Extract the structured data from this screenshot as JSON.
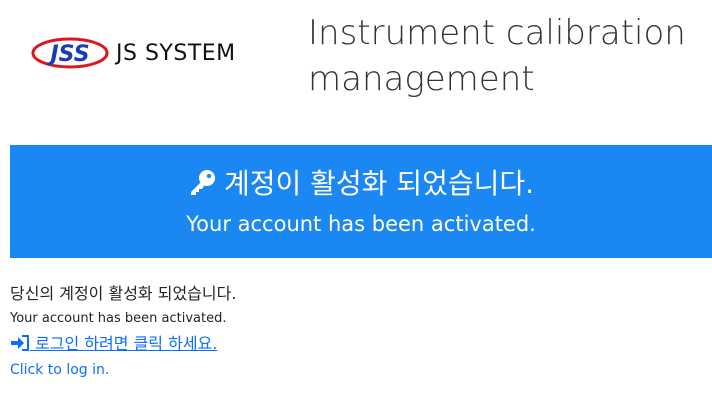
{
  "header": {
    "logo_text": "JSS",
    "brand_name": "JS SYSTEM",
    "app_title": "Instrument calibration management"
  },
  "banner": {
    "icon": "key-icon",
    "title_ko": "계정이 활성화 되었습니다.",
    "title_en": "Your account has been activated.",
    "background_color": "#1b87f3"
  },
  "content": {
    "message_ko": "당신의 계정이 활성화 되었습니다.",
    "message_en": "Your account has been activated.",
    "login_link_icon": "sign-in-icon",
    "login_link_ko": " 로그인 하려면 클릭 하세요.",
    "login_link_en": "Click to log in.",
    "link_color": "#0d6efd"
  }
}
